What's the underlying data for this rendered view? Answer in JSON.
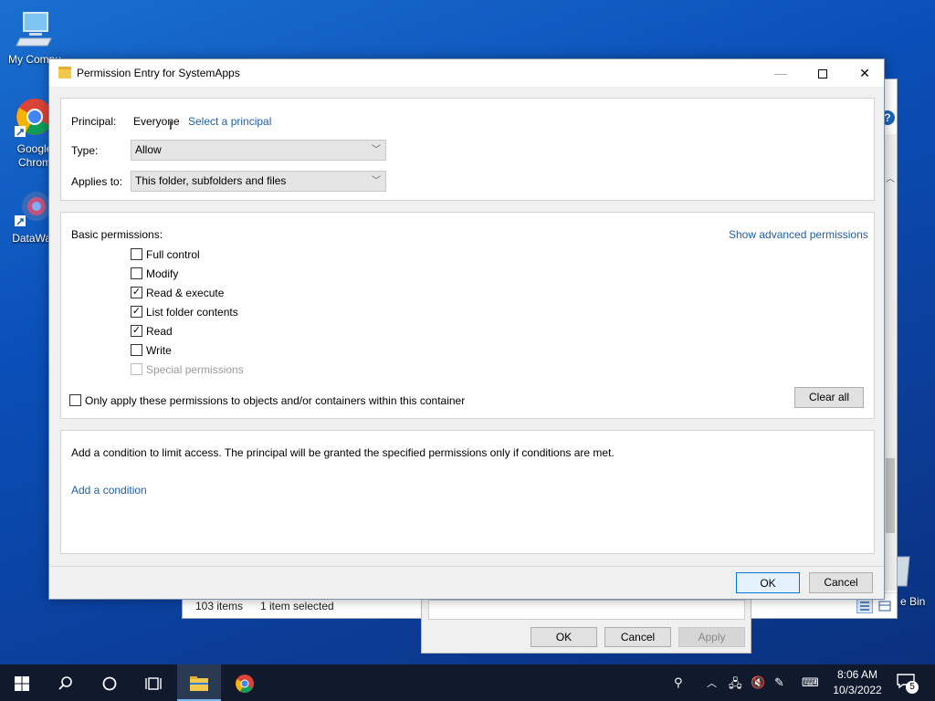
{
  "desktop": {
    "icons": [
      {
        "label": "My Compu",
        "name": "my-computer"
      },
      {
        "label": "Google\nChrom",
        "name": "google-chrome"
      },
      {
        "label": "DataWag",
        "name": "datawagon"
      }
    ],
    "recycle_label": "e Bin"
  },
  "explorer": {
    "items_count": "103 items",
    "selection": "1 item selected",
    "help_glyph": "?"
  },
  "properties": {
    "ok_label": "OK",
    "cancel_label": "Cancel",
    "apply_label": "Apply"
  },
  "dialog": {
    "title": "Permission Entry for SystemApps",
    "principal_label": "Principal:",
    "principal_value": "Everyone",
    "select_principal_link": "Select a principal",
    "type_label": "Type:",
    "type_value": "Allow",
    "applies_to_label": "Applies to:",
    "applies_to_value": "This folder, subfolders and files",
    "basic_permissions_label": "Basic permissions:",
    "show_advanced_link": "Show advanced permissions",
    "permissions": [
      {
        "label": "Full control",
        "checked": false,
        "disabled": false
      },
      {
        "label": "Modify",
        "checked": false,
        "disabled": false
      },
      {
        "label": "Read & execute",
        "checked": true,
        "disabled": false
      },
      {
        "label": "List folder contents",
        "checked": true,
        "disabled": false
      },
      {
        "label": "Read",
        "checked": true,
        "disabled": false
      },
      {
        "label": "Write",
        "checked": false,
        "disabled": false
      },
      {
        "label": "Special permissions",
        "checked": false,
        "disabled": true
      }
    ],
    "only_apply_label": "Only apply these permissions to objects and/or containers within this container",
    "only_apply_checked": false,
    "clear_all_label": "Clear all",
    "condition_text": "Add a condition to limit access. The principal will be granted the specified permissions only if conditions are met.",
    "add_condition_link": "Add a condition",
    "ok_label": "OK",
    "cancel_label": "Cancel"
  },
  "taskbar": {
    "time": "8:06 AM",
    "date": "10/3/2022",
    "notification_count": "5"
  },
  "colors": {
    "accent": "#0078d7",
    "link": "#1f5fa5",
    "taskbar": "#101a2c"
  }
}
